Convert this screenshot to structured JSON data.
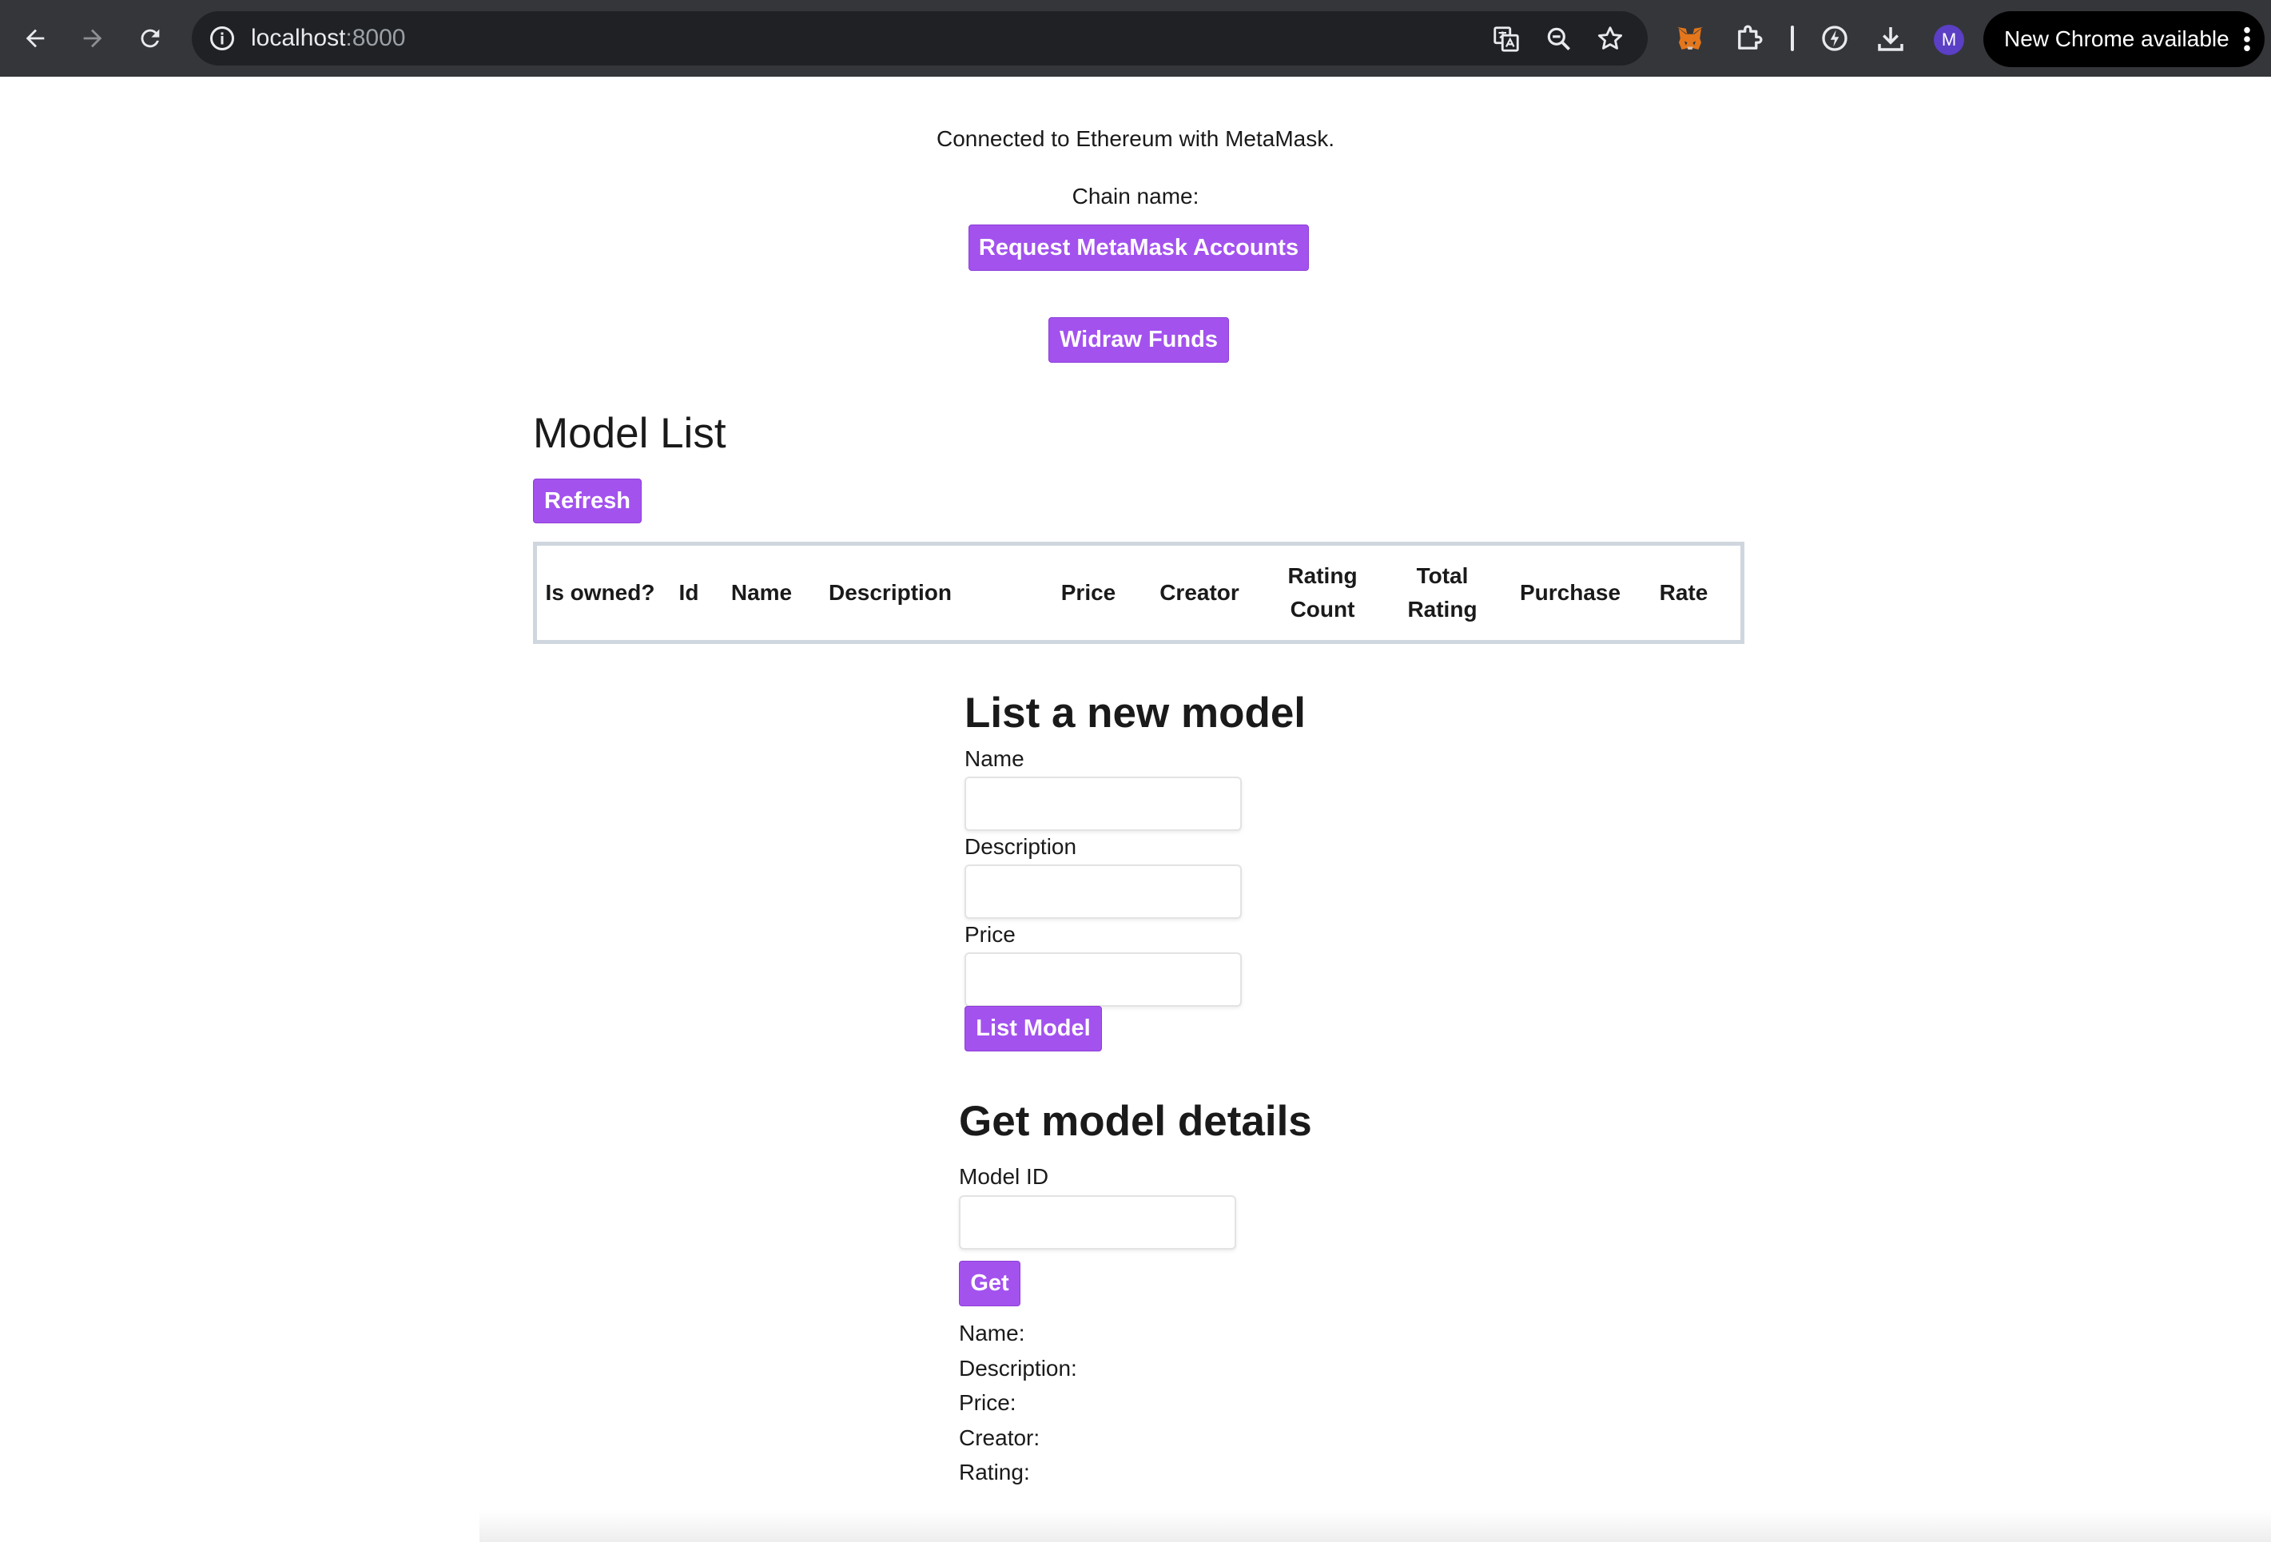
{
  "browser": {
    "url_host": "localhost",
    "url_port": ":8000",
    "profile_initial": "M",
    "update_label": "New Chrome available",
    "icons": [
      "back-arrow-icon",
      "forward-arrow-icon",
      "reload-icon",
      "site-info-icon",
      "translate-icon",
      "zoom-icon",
      "bookmark-star-icon",
      "metamask-fox-icon",
      "extensions-puzzle-icon",
      "performance-icon",
      "download-icon",
      "more-vert-icon"
    ]
  },
  "status": {
    "connected": "Connected to Ethereum with MetaMask.",
    "chain": "Chain name:"
  },
  "buttons": {
    "request_accounts": "Request MetaMask Accounts",
    "withdraw": "Widraw Funds",
    "refresh": "Refresh",
    "list_model": "List Model",
    "get": "Get"
  },
  "model_list": {
    "title": "Model List",
    "columns": [
      "Is owned?",
      "Id",
      "Name",
      "Description",
      "Price",
      "Creator",
      "Rating Count",
      "Total Rating",
      "Purchase",
      "Rate"
    ]
  },
  "list_form": {
    "title": "List a new model",
    "name_label": "Name",
    "description_label": "Description",
    "price_label": "Price",
    "name_value": "",
    "description_value": "",
    "price_value": ""
  },
  "details_form": {
    "title": "Get model details",
    "model_id_label": "Model ID",
    "model_id_value": "",
    "name": "Name:",
    "description": "Description:",
    "price": "Price:",
    "creator": "Creator:",
    "rating": "Rating:"
  },
  "colors": {
    "accent": "#a352ee",
    "chrome_bg": "#35363a",
    "omnibox_bg": "#202124",
    "table_border": "#cfd6de"
  }
}
